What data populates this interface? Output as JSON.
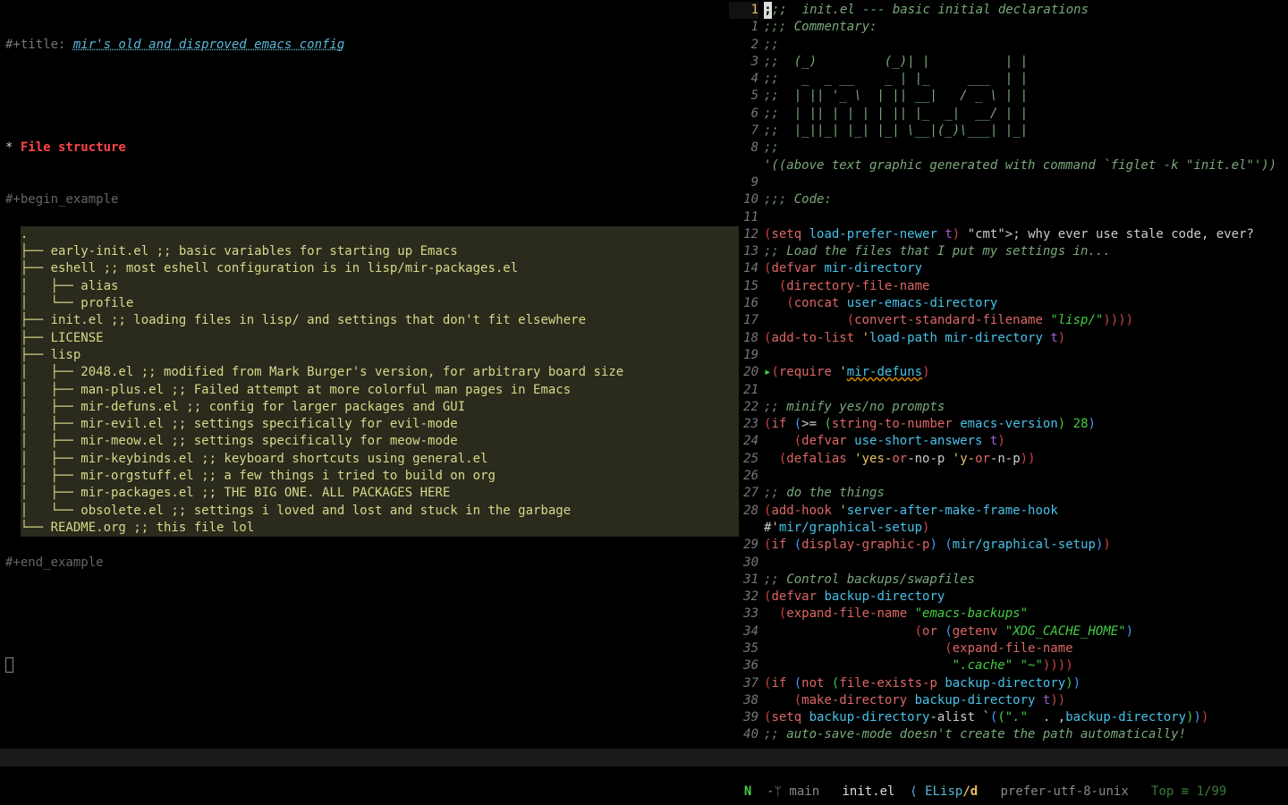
{
  "left": {
    "title_key": "#+title: ",
    "title_val": "mir's old and disproved emacs config",
    "h1_star": "* ",
    "h1": "File structure",
    "begin": "#+begin_example",
    "end": "#+end_example",
    "tree": ".\n├── early-init.el ;; basic variables for starting up Emacs\n├── eshell ;; most eshell configuration is in lisp/mir-packages.el\n│   ├── alias\n│   └── profile\n├── init.el ;; loading files in lisp/ and settings that don't fit elsewhere\n├── LICENSE\n├── lisp\n│   ├── 2048.el ;; modified from Mark Burger's version, for arbitrary board size\n│   ├── man-plus.el ;; Failed attempt at more colorful man pages in Emacs\n│   ├── mir-defuns.el ;; config for larger packages and GUI\n│   ├── mir-evil.el ;; settings specifically for evil-mode\n│   ├── mir-meow.el ;; settings specifically for meow-mode\n│   ├── mir-keybinds.el ;; keyboard shortcuts using general.el\n│   ├── mir-orgstuff.el ;; a few things i tried to build on org\n│   ├── mir-packages.el ;; THE BIG ONE. ALL PACKAGES HERE\n│   └── obsolete.el ;; settings i loved and lost and stuck in the garbage\n└── README.org ;; this file lol"
  },
  "right": {
    "numcol_cur": "1",
    "lines": [
      {
        "n": "1",
        "t": ";;;  init.el --- basic initial declarations",
        "cmt": true,
        "cur": true
      },
      {
        "n": "1",
        "t": ";;; Commentary:"
      },
      {
        "n": "2",
        "t": ";;"
      },
      {
        "n": "3",
        "t": ";;  (_)         (_)| |          | |"
      },
      {
        "n": "4",
        "t": ";;   _  _ __    _ | |_     ___  | |"
      },
      {
        "n": "5",
        "t": ";;  | || '_ \\  | || __|   / _ \\ | |"
      },
      {
        "n": "6",
        "t": ";;  | || | | | | || |_  _|  __/ | |"
      },
      {
        "n": "7",
        "t": ";;  |_||_| |_| |_| \\__|(_)\\___| |_|"
      },
      {
        "n": "8",
        "t": ";;"
      },
      {
        "n": "8w",
        "t": "'((above text graphic generated with command `figlet -k \"init.el\"'))",
        "wrap": true
      },
      {
        "n": "9",
        "t": ""
      },
      {
        "n": "10",
        "t": ";;; Code:"
      },
      {
        "n": "11",
        "t": ""
      },
      {
        "n": "12",
        "t": "(setq load-prefer-newer t) ; why ever use stale code, ever?"
      },
      {
        "n": "13",
        "t": ";; Load the files that I put my settings in..."
      },
      {
        "n": "14",
        "t": "(defvar mir-directory"
      },
      {
        "n": "15",
        "t": "  (directory-file-name"
      },
      {
        "n": "16",
        "t": "   (concat user-emacs-directory"
      },
      {
        "n": "17",
        "t": "           (convert-standard-filename \"lisp/\"))))"
      },
      {
        "n": "18",
        "t": "(add-to-list 'load-path mir-directory t)"
      },
      {
        "n": "19",
        "t": ""
      },
      {
        "n": "20",
        "t": "(require 'mir-defuns)",
        "mark": "▸"
      },
      {
        "n": "21",
        "t": ""
      },
      {
        "n": "22",
        "t": ";; minify yes/no prompts"
      },
      {
        "n": "23",
        "t": "(if (>= (string-to-number emacs-version) 28)"
      },
      {
        "n": "24",
        "t": "    (defvar use-short-answers t)"
      },
      {
        "n": "25",
        "t": "  (defalias 'yes-or-no-p 'y-or-n-p))"
      },
      {
        "n": "26",
        "t": ""
      },
      {
        "n": "27",
        "t": ";; do the things"
      },
      {
        "n": "28",
        "t": "(add-hook 'server-after-make-frame-hook #'mir/graphical-setup)",
        "wrap2": true
      },
      {
        "n": "29",
        "t": "(if (display-graphic-p) (mir/graphical-setup))"
      },
      {
        "n": "30",
        "t": ""
      },
      {
        "n": "31",
        "t": ";; Control backups/swapfiles"
      },
      {
        "n": "32",
        "t": "(defvar backup-directory"
      },
      {
        "n": "33",
        "t": "  (expand-file-name \"emacs-backups\""
      },
      {
        "n": "34",
        "t": "                    (or (getenv \"XDG_CACHE_HOME\")"
      },
      {
        "n": "35",
        "t": "                        (expand-file-name"
      },
      {
        "n": "36",
        "t": "                         \".cache\" \"~\"))))"
      },
      {
        "n": "37",
        "t": "(if (not (file-exists-p backup-directory))"
      },
      {
        "n": "38",
        "t": "    (make-directory backup-directory t))"
      },
      {
        "n": "39",
        "t": "(setq backup-directory-alist `((\".\"  . ,backup-directory)))"
      },
      {
        "n": "40",
        "t": ";; auto-save-mode doesn't create the path automatically!"
      }
    ]
  },
  "modeline": {
    "evil": "N",
    "sep0": "  ",
    "vc_icon": "-ᛘ ",
    "branch": "main",
    "buf": "init.el",
    "sep": "  ⟨ ",
    "mode": "ELisp",
    "mod": "/d",
    "enc": "   prefer-utf-8-unix",
    "pos": "   Top ≡ 1/99"
  }
}
